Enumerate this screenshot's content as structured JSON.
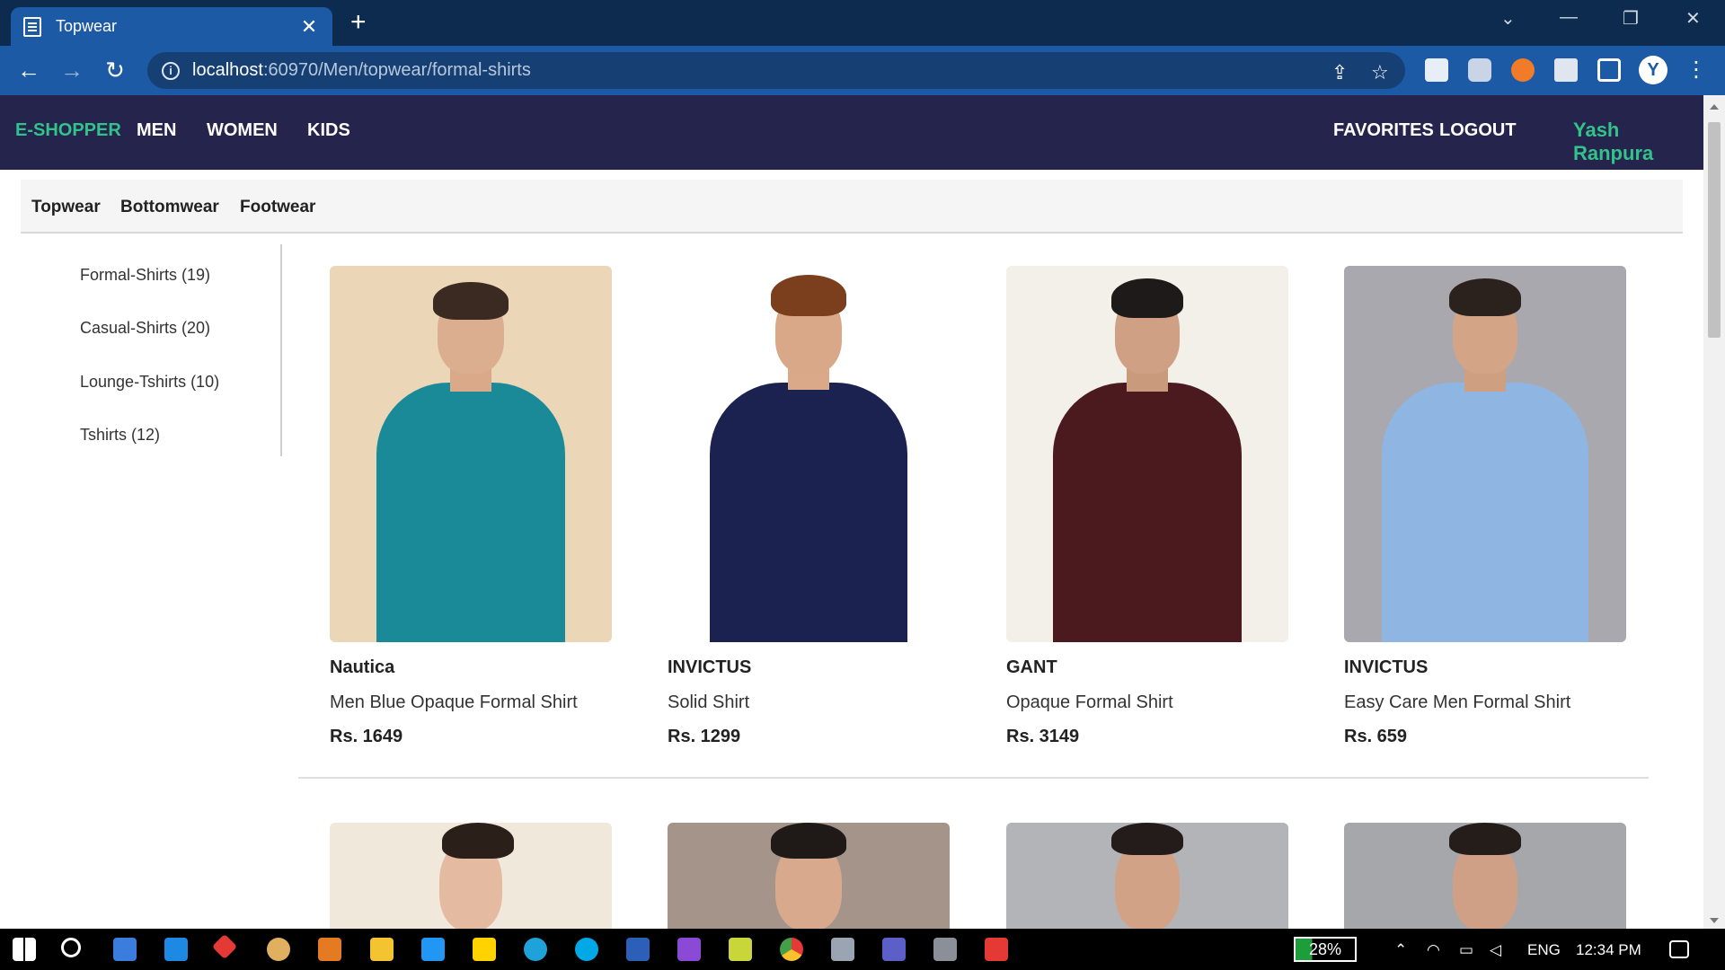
{
  "browser": {
    "tab_title": "Topwear",
    "tab_close": "✕",
    "new_tab": "+",
    "url_host": "localhost",
    "url_rest": ":60970/Men/topwear/formal-shirts",
    "profile_initial": "Y",
    "window_controls": {
      "tabs_menu": "⌄",
      "minimize": "—",
      "restore": "❐",
      "close": "✕"
    },
    "nav": {
      "back": "←",
      "forward": "→",
      "reload": "↻"
    },
    "omni_icons": {
      "share": "⇪",
      "star": "☆",
      "menu": "⋮"
    }
  },
  "navbar": {
    "brand": "E-SHOPPER",
    "links": [
      "MEN",
      "WOMEN",
      "KIDS"
    ],
    "favorites": "FAVORITES",
    "logout": "LOGOUT",
    "user": "Yash Ranpura"
  },
  "subnav": [
    "Topwear",
    "Bottomwear",
    "Footwear"
  ],
  "sidebar": [
    "Formal-Shirts (19)",
    "Casual-Shirts (20)",
    "Lounge-Tshirts (10)",
    "Tshirts (12)"
  ],
  "products": [
    {
      "brand": "Nautica",
      "name": "Men Blue Opaque Formal Shirt",
      "price": "Rs. 1649"
    },
    {
      "brand": "INVICTUS",
      "name": "Solid Shirt",
      "price": "Rs. 1299"
    },
    {
      "brand": "GANT",
      "name": "Opaque Formal Shirt",
      "price": "Rs. 3149"
    },
    {
      "brand": "INVICTUS",
      "name": "Easy Care Men Formal Shirt",
      "price": "Rs. 659"
    }
  ],
  "taskbar": {
    "battery": "28%",
    "language": "ENG",
    "time": "12:34 PM"
  },
  "colors": {
    "navbar_bg": "#25244d",
    "brand_green": "#32c28a",
    "chrome_blue": "#1d5aa6"
  }
}
